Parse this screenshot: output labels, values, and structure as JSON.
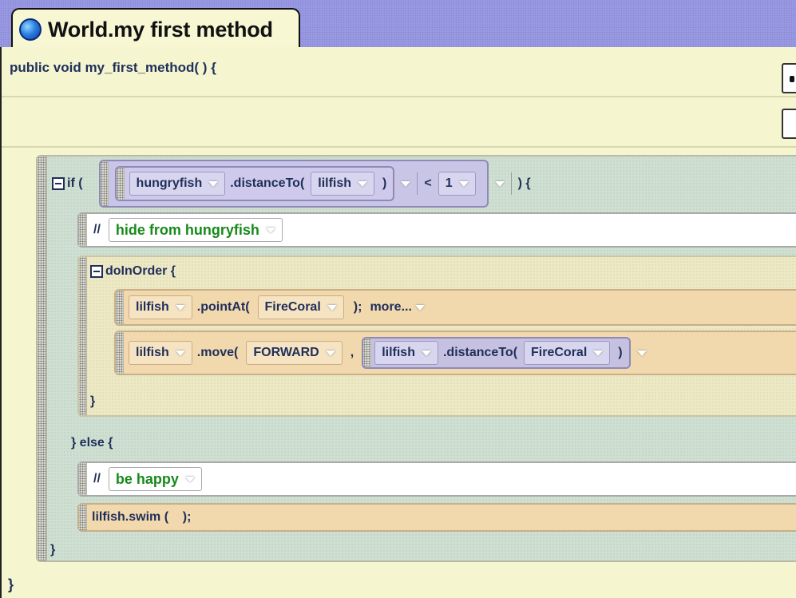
{
  "tab": {
    "title": "World.my first method",
    "icon": "globe-icon"
  },
  "method": {
    "signature": "public void my_first_method( ) {",
    "closing_brace": "}"
  },
  "if_block": {
    "keyword": "if (",
    "condition": {
      "subject": "hungryfish",
      "func": ".distanceTo(",
      "arg": "lilfish",
      "close_paren": ")",
      "operator": "<",
      "value": "1"
    },
    "open_brace": ") {",
    "else_text": "} else {",
    "closing_brace": "}"
  },
  "comment1": {
    "slashes": "//",
    "text": "hide from hungryfish"
  },
  "do_in_order": {
    "label": "doInOrder {",
    "closing_brace": "}",
    "stmt1": {
      "subject": "lilfish",
      "method": ".pointAt(",
      "arg": "FireCoral",
      "close": ");",
      "more": "more..."
    },
    "stmt2": {
      "subject": "lilfish",
      "method": ".move(",
      "arg1": "FORWARD",
      "comma": ",",
      "inner_subject": "lilfish",
      "inner_func": ".distanceTo(",
      "inner_arg": "FireCoral",
      "inner_close": ")"
    }
  },
  "comment2": {
    "slashes": "//",
    "text": "be happy"
  },
  "swim_stmt": {
    "text": "lilfish.swim (    );"
  },
  "colors": {
    "tab_strip": "#9d9de6",
    "editor_bg": "#f5f5cf",
    "if_block_bg": "#cfe0d2",
    "statement_bg": "#f1d8ad",
    "function_bg": "#c6c1e0",
    "comment_text": "#178a1a"
  }
}
